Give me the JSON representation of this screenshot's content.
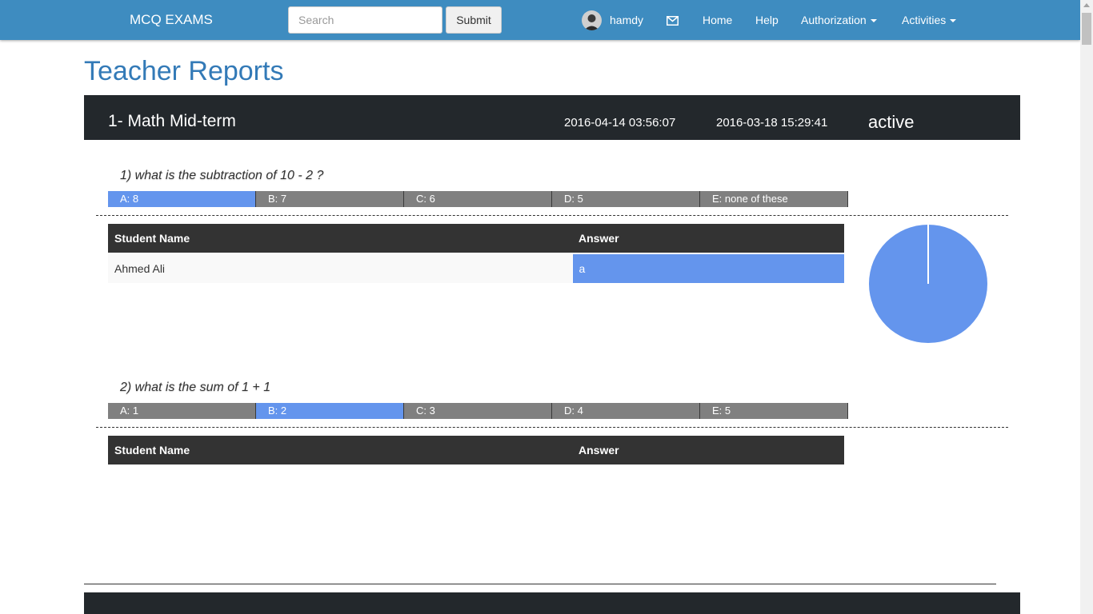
{
  "navbar": {
    "brand": "MCQ EXAMS",
    "search_placeholder": "Search",
    "submit_label": "Submit",
    "user_name": "hamdy",
    "links": {
      "home": "Home",
      "help": "Help",
      "authorization": "Authorization",
      "activities": "Activities"
    }
  },
  "page": {
    "title": "Teacher Reports"
  },
  "exam": {
    "name": "1- Math Mid-term",
    "date_end": "2016-04-14 03:56:07",
    "date_start": "2016-03-18 15:29:41",
    "status": "active"
  },
  "questions": [
    {
      "text": "1) what is the subtraction of 10 - 2 ?",
      "options": [
        "A: 8",
        "B: 7",
        "C: 6",
        "D: 5",
        "E: none of these"
      ],
      "correct_index": 0,
      "table_headers": {
        "name": "Student Name",
        "answer": "Answer"
      },
      "responses": [
        {
          "name": "Ahmed Ali",
          "answer": "a"
        }
      ],
      "chart_data": {
        "type": "pie",
        "labels": [
          "a"
        ],
        "values": [
          1
        ],
        "colors": [
          "#6495ed"
        ]
      }
    },
    {
      "text": "2) what is the sum of 1 + 1",
      "options": [
        "A: 1",
        "B: 2",
        "C: 3",
        "D: 4",
        "E: 5"
      ],
      "correct_index": 1,
      "table_headers": {
        "name": "Student Name",
        "answer": "Answer"
      },
      "responses": []
    }
  ],
  "colors": {
    "navbar": "#3e8cc0",
    "title": "#337ab7",
    "correct": "#6495ed",
    "option": "#808080",
    "header_dark": "#23282c"
  }
}
